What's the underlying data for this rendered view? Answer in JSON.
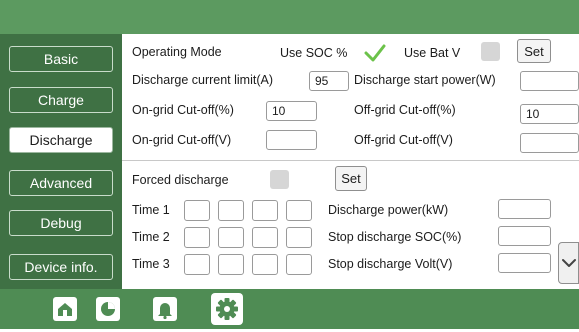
{
  "tabs": [
    {
      "label": "Basic"
    },
    {
      "label": "Charge"
    },
    {
      "label": "Discharge"
    },
    {
      "label": "Advanced"
    },
    {
      "label": "Debug"
    },
    {
      "label": "Device info."
    }
  ],
  "operating_mode": {
    "label": "Operating Mode",
    "use_soc_label": "Use SOC %",
    "use_soc_checked": true,
    "use_bat_v_label": "Use Bat V",
    "use_bat_v_checked": false,
    "set_label": "Set"
  },
  "fields": {
    "discharge_current_limit": {
      "label": "Discharge current limit(A)",
      "value": "95"
    },
    "discharge_start_power": {
      "label": "Discharge start power(W)",
      "value": ""
    },
    "on_grid_cutoff_pct": {
      "label": "On-grid Cut-off(%)",
      "value": "10"
    },
    "off_grid_cutoff_pct": {
      "label": "Off-grid Cut-off(%)",
      "value": "10"
    },
    "on_grid_cutoff_v": {
      "label": "On-grid Cut-off(V)",
      "value": ""
    },
    "off_grid_cutoff_v": {
      "label": "Off-grid Cut-off(V)",
      "value": ""
    }
  },
  "forced": {
    "label": "Forced discharge",
    "checked": false,
    "set_label": "Set",
    "time1_label": "Time 1",
    "time2_label": "Time 2",
    "time3_label": "Time 3",
    "discharge_power_label": "Discharge power(kW)",
    "stop_soc_label": "Stop discharge SOC(%)",
    "stop_volt_label": "Stop discharge Volt(V)"
  },
  "bottom_nav": [
    "home-icon",
    "chart-icon",
    "alarm-bell-icon",
    "settings-gear-icon"
  ],
  "colors": {
    "header": "#5c9a60",
    "sidebar": "#3f7144",
    "bottom": "#4f8c54",
    "check": "#6cc24a"
  }
}
